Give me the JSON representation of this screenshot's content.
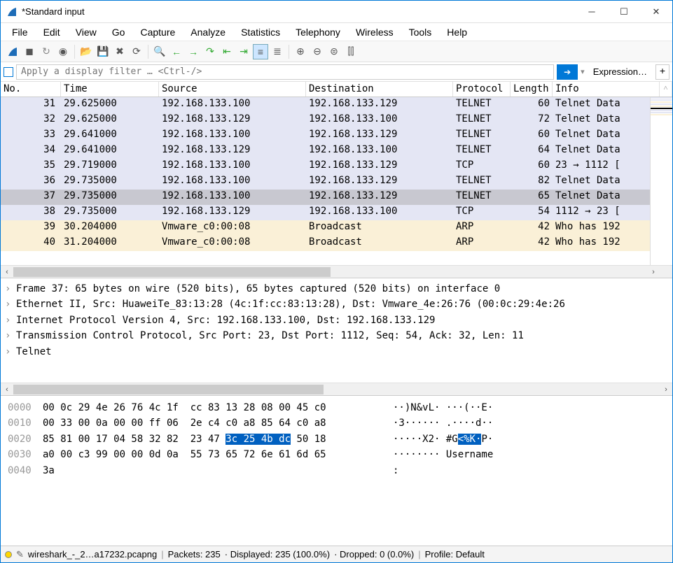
{
  "title": "*Standard input",
  "menu": [
    "File",
    "Edit",
    "View",
    "Go",
    "Capture",
    "Analyze",
    "Statistics",
    "Telephony",
    "Wireless",
    "Tools",
    "Help"
  ],
  "filter_placeholder": "Apply a display filter … <Ctrl-/>",
  "expression_label": "Expression…",
  "columns": {
    "no": "No.",
    "time": "Time",
    "src": "Source",
    "dst": "Destination",
    "proto": "Protocol",
    "len": "Length",
    "info": "Info"
  },
  "packets": [
    {
      "no": "31",
      "time": "29.625000",
      "src": "192.168.133.100",
      "dst": "192.168.133.129",
      "proto": "TELNET",
      "len": "60",
      "info": "Telnet Data",
      "cls": "telnet1"
    },
    {
      "no": "32",
      "time": "29.625000",
      "src": "192.168.133.129",
      "dst": "192.168.133.100",
      "proto": "TELNET",
      "len": "72",
      "info": "Telnet Data",
      "cls": "telnet2"
    },
    {
      "no": "33",
      "time": "29.641000",
      "src": "192.168.133.100",
      "dst": "192.168.133.129",
      "proto": "TELNET",
      "len": "60",
      "info": "Telnet Data",
      "cls": "telnet1"
    },
    {
      "no": "34",
      "time": "29.641000",
      "src": "192.168.133.129",
      "dst": "192.168.133.100",
      "proto": "TELNET",
      "len": "64",
      "info": "Telnet Data",
      "cls": "telnet2"
    },
    {
      "no": "35",
      "time": "29.719000",
      "src": "192.168.133.100",
      "dst": "192.168.133.129",
      "proto": "TCP",
      "len": "60",
      "info": "23 → 1112 [",
      "cls": "tcp"
    },
    {
      "no": "36",
      "time": "29.735000",
      "src": "192.168.133.100",
      "dst": "192.168.133.129",
      "proto": "TELNET",
      "len": "82",
      "info": "Telnet Data",
      "cls": "telnet1"
    },
    {
      "no": "37",
      "time": "29.735000",
      "src": "192.168.133.100",
      "dst": "192.168.133.129",
      "proto": "TELNET",
      "len": "65",
      "info": "Telnet Data",
      "cls": "sel"
    },
    {
      "no": "38",
      "time": "29.735000",
      "src": "192.168.133.129",
      "dst": "192.168.133.100",
      "proto": "TCP",
      "len": "54",
      "info": "1112 → 23 [",
      "cls": "tcp"
    },
    {
      "no": "39",
      "time": "30.204000",
      "src": "Vmware_c0:00:08",
      "dst": "Broadcast",
      "proto": "ARP",
      "len": "42",
      "info": "Who has 192",
      "cls": "arp"
    },
    {
      "no": "40",
      "time": "31.204000",
      "src": "Vmware_c0:00:08",
      "dst": "Broadcast",
      "proto": "ARP",
      "len": "42",
      "info": "Who has 192",
      "cls": "arp"
    }
  ],
  "details": [
    "Frame 37: 65 bytes on wire (520 bits), 65 bytes captured (520 bits) on interface 0",
    "Ethernet II, Src: HuaweiTe_83:13:28 (4c:1f:cc:83:13:28), Dst: Vmware_4e:26:76 (00:0c:29:4e:26",
    "Internet Protocol Version 4, Src: 192.168.133.100, Dst: 192.168.133.129",
    "Transmission Control Protocol, Src Port: 23, Dst Port: 1112, Seq: 54, Ack: 32, Len: 11",
    "Telnet"
  ],
  "hex": [
    {
      "off": "0000",
      "b": "00 0c 29 4e 26 76 4c 1f  cc 83 13 28 08 00 45 c0",
      "a": "··)N&vL· ···(··E·"
    },
    {
      "off": "0010",
      "b": "00 33 00 0a 00 00 ff 06  2e c4 c0 a8 85 64 c0 a8",
      "a": "·3······ .····d··"
    },
    {
      "off": "0020",
      "b1": "85 81 00 17 04 58 32 82  23 47 ",
      "bsel": "3c 25 4b dc",
      "b2": " 50 18",
      "a1": "·····X2· #G",
      "asel": "<%K·",
      "a2": "P·"
    },
    {
      "off": "0030",
      "b": "a0 00 c3 99 00 00 0d 0a  55 73 65 72 6e 61 6d 65",
      "a": "········ Username"
    },
    {
      "off": "0040",
      "b": "3a",
      "a": ":"
    }
  ],
  "status": {
    "file": "wireshark_-_2…a17232.pcapng",
    "packets": "Packets: 235",
    "displayed": "· Displayed: 235 (100.0%)",
    "dropped": "· Dropped: 0 (0.0%)",
    "profile": "Profile: Default"
  }
}
